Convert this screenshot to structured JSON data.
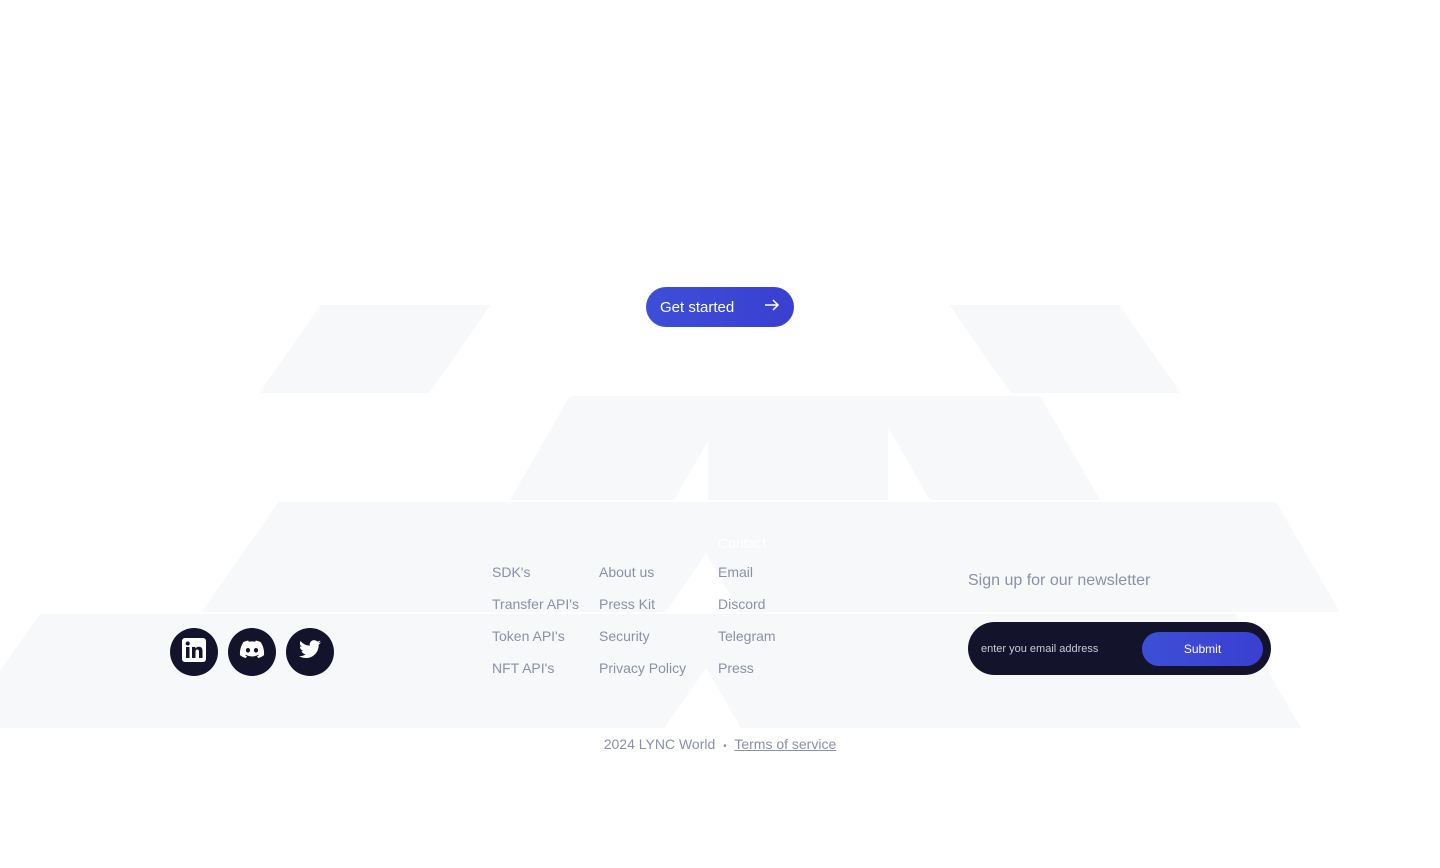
{
  "cta": {
    "label": "Get started",
    "icon": "arrow-right-icon"
  },
  "social": [
    {
      "name": "linkedin-icon"
    },
    {
      "name": "discord-icon"
    },
    {
      "name": "twitter-icon"
    }
  ],
  "columns": {
    "developers": [
      "SDK's",
      "Transfer API's",
      "Token API's",
      "NFT API's"
    ],
    "company": [
      "About us",
      "Press Kit",
      "Security",
      "Privacy Policy"
    ],
    "contact_heading": "Contact",
    "contact": [
      "Email",
      "Discord",
      "Telegram",
      "Press"
    ]
  },
  "newsletter": {
    "title": "Sign up for our newsletter",
    "placeholder": "enter you email address",
    "submit": "Submit"
  },
  "footer": {
    "copyright": "2024 LYNC World",
    "separator": "•",
    "terms": "Terms of service"
  },
  "colors": {
    "accent": "#3d4fd6",
    "dark": "#13142b",
    "muted_text": "#8a90a8"
  }
}
